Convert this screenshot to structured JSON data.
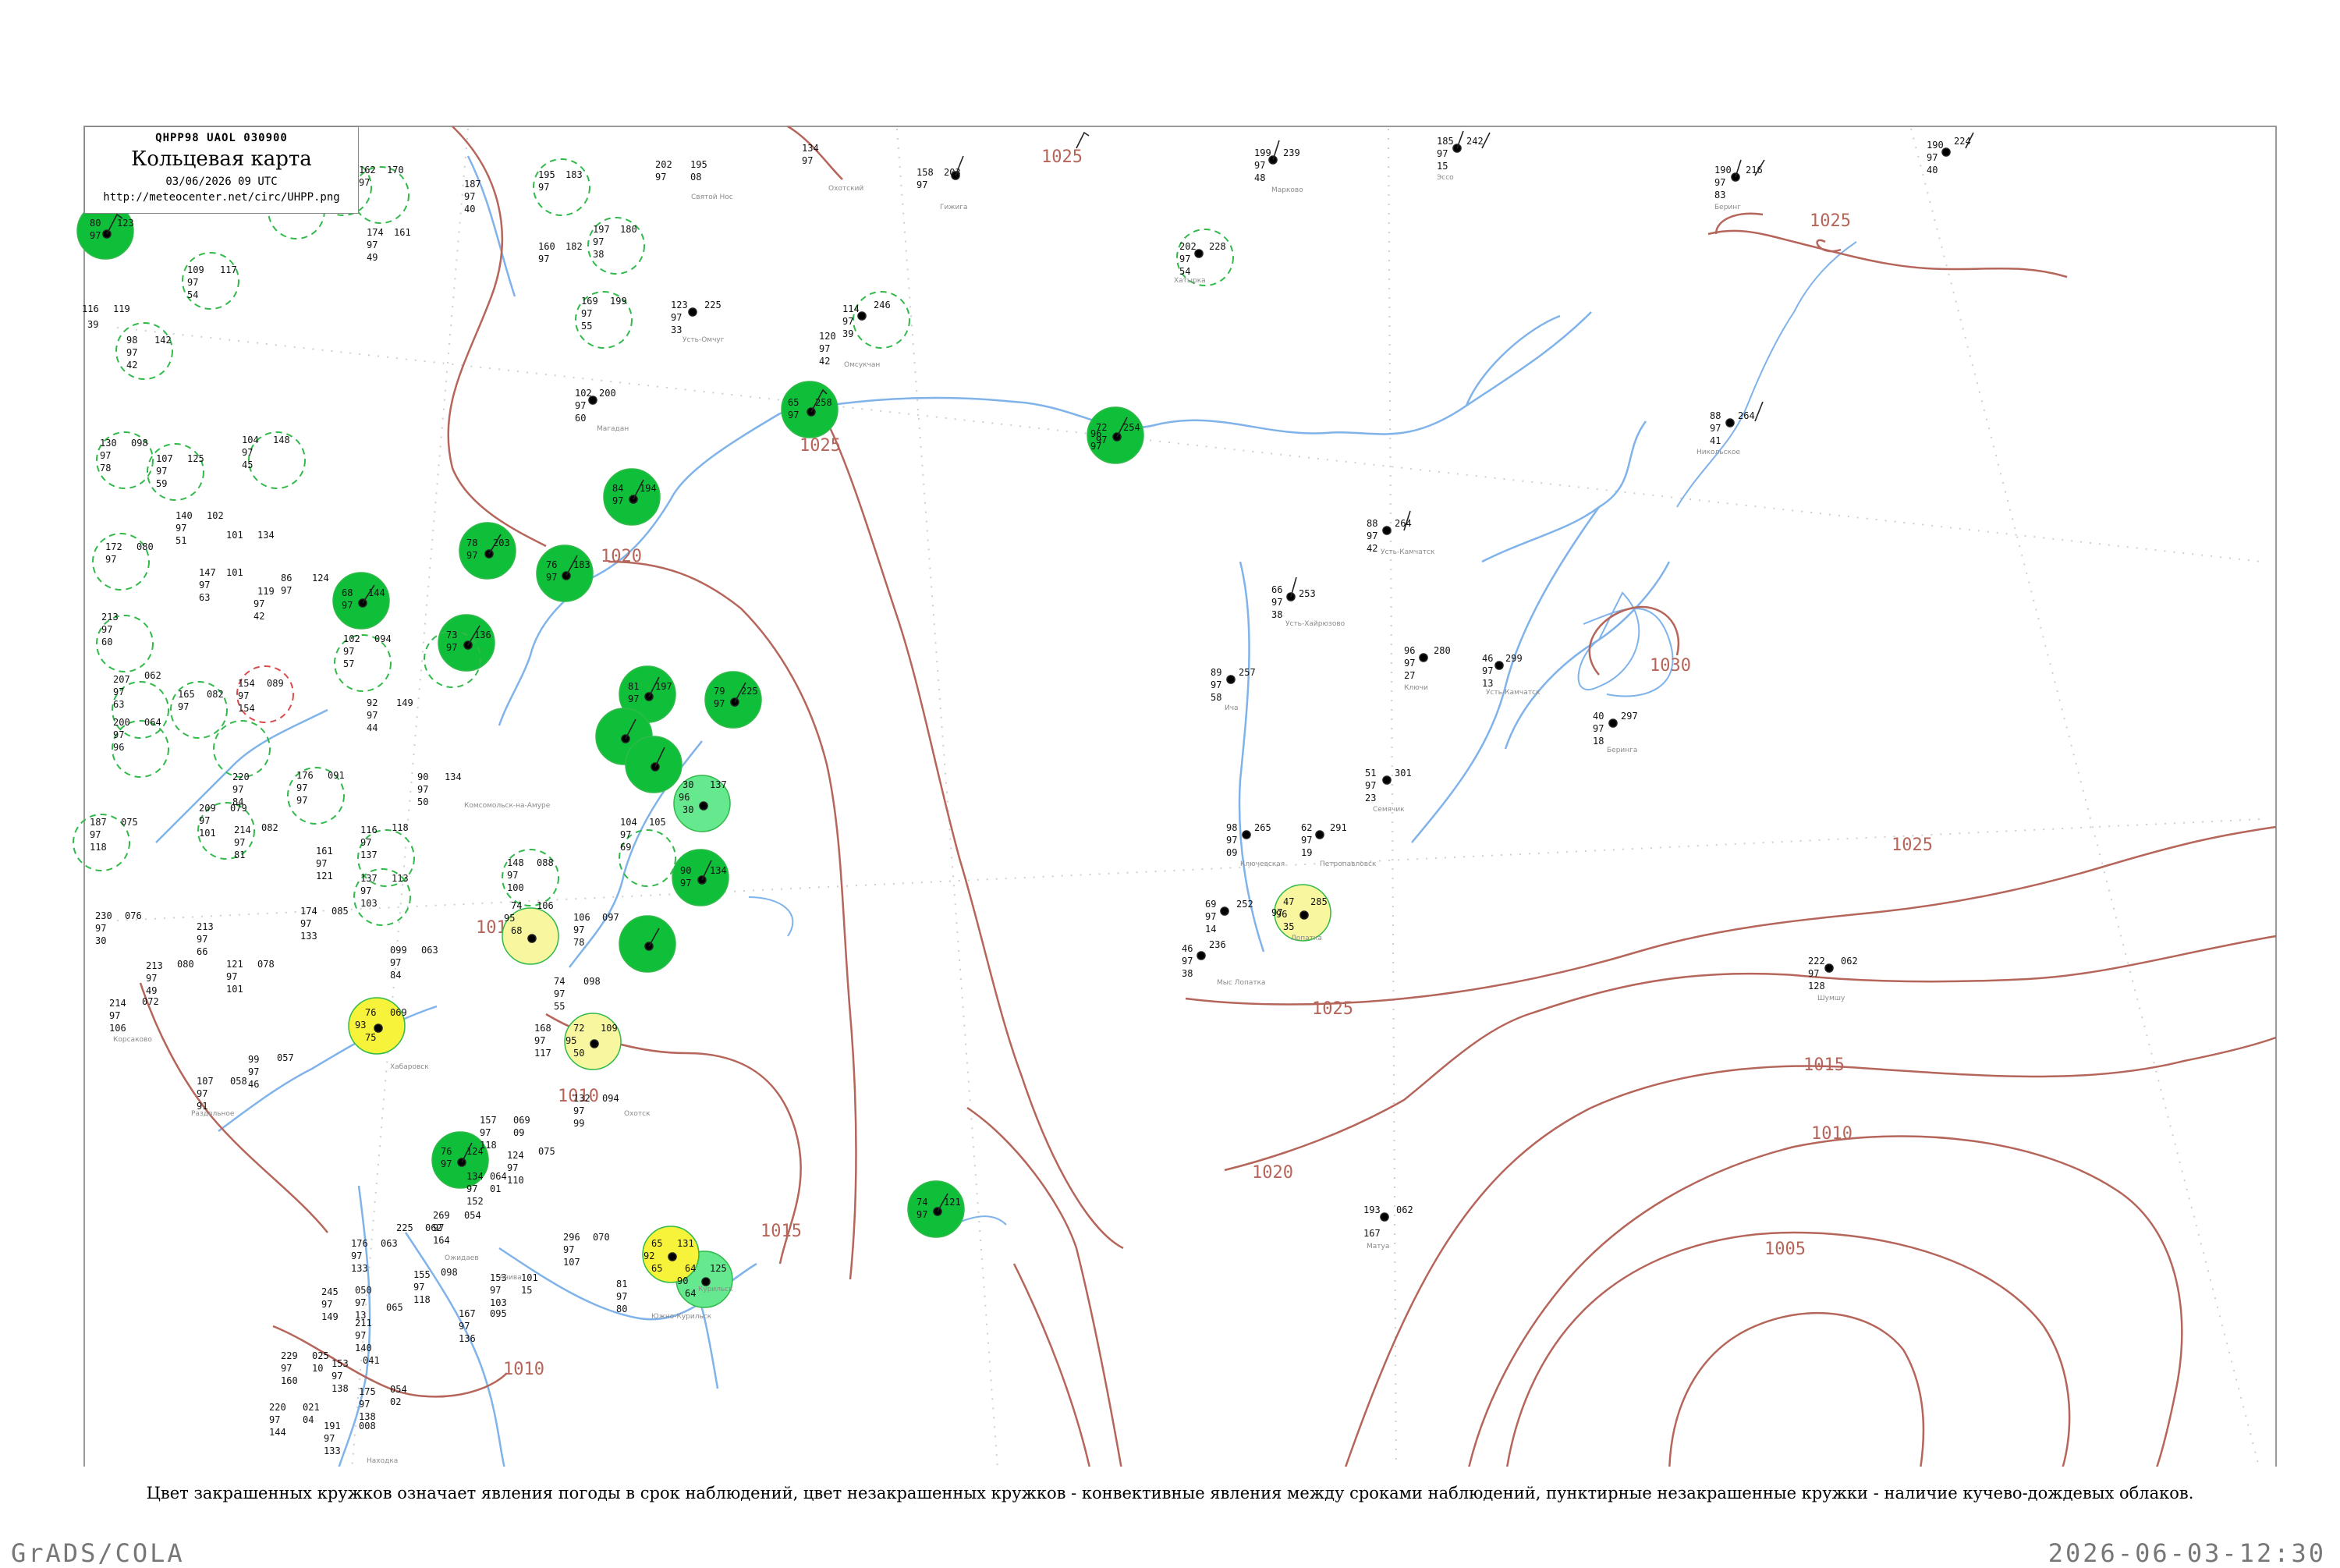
{
  "title": {
    "code": "QHPP98  UAOL  030900",
    "main": "Кольцевая карта",
    "date": "03/06/2026 09 UTC",
    "url": "http://meteocenter.net/circ/UHPP.png"
  },
  "isobar_labels": [
    "1025",
    "1025",
    "1025",
    "1025",
    "1020",
    "1020",
    "1015",
    "1015",
    "1010",
    "1010",
    "1010",
    "1030",
    "1005",
    "1025",
    "1015",
    "1010"
  ],
  "station_colors": {
    "green": "#0fbf3a",
    "light_green": "#66e88f",
    "yellow": "#f7f23a",
    "light_yellow": "#f8f7a0",
    "dashed_ring": "#31b94a",
    "red_ring": "#d94b4b"
  },
  "line_colors": {
    "isobar": "#b5655a",
    "river": "#7fb3ea",
    "grid": "#c9c9c9"
  },
  "caption": "Цвет закрашенных кружков означает явления погоды в срок наблюдений, цвет незакрашенных кружков - конвективные явления между сроками наблюдений, пунктирные незакрашенные кружки - наличие кучево-дождевых облаков.",
  "footer": {
    "left": "GrADS/COLA",
    "right": "2026-06-03-12:30"
  }
}
